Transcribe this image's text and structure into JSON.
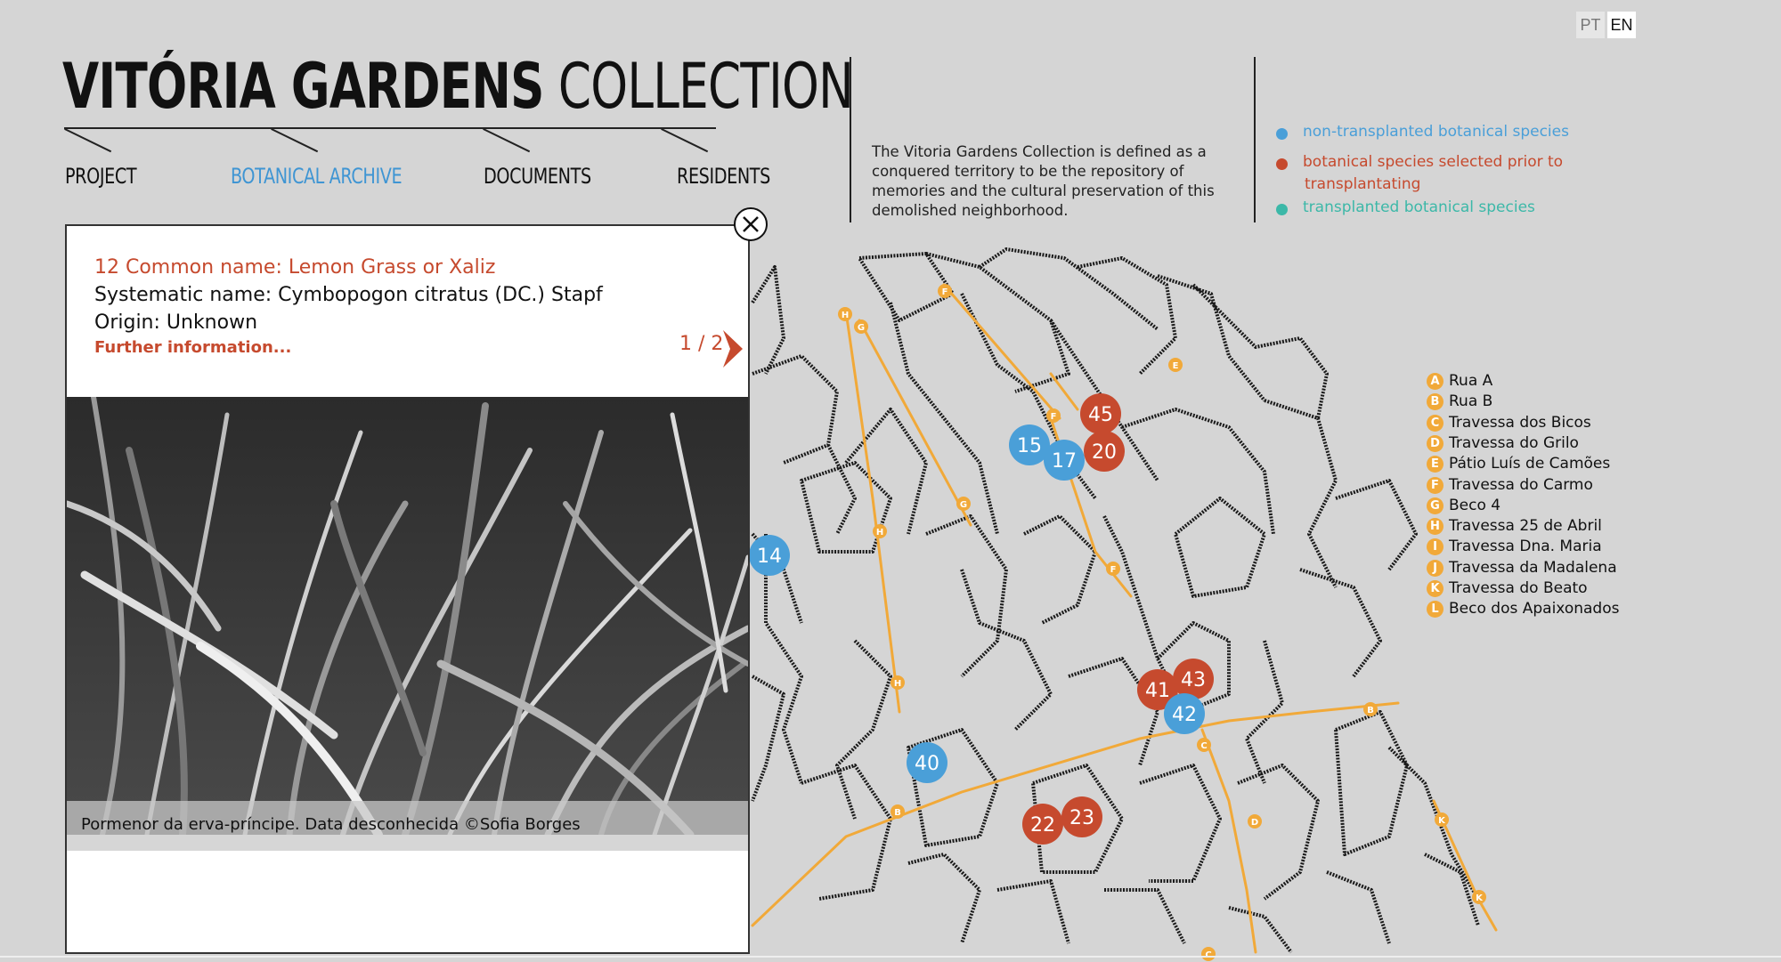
{
  "lang": {
    "pt": "PT",
    "en": "EN"
  },
  "title": {
    "bold": "VITÓRIA GARDENS",
    "light": " COLLECTION"
  },
  "nav": [
    {
      "label": "PROJECT"
    },
    {
      "label": "BOTANICAL ARCHIVE"
    },
    {
      "label": "DOCUMENTS"
    },
    {
      "label": "RESIDENTS"
    }
  ],
  "description": "The Vitoria Gardens Collection is defined as a conquered territory to be the repository of memories and the cultural preservation of this demolished neighborhood.",
  "legend": [
    {
      "label": "non-transplanted botanical species",
      "color": "#4a9fd8"
    },
    {
      "label": "botanical species selected prior to",
      "label2": "transplantating",
      "color": "#c64a2e"
    },
    {
      "label": "transplanted botanical species",
      "color": "#3cb8a8"
    }
  ],
  "colors": {
    "accent_blue": "#3f95d3",
    "accent_red": "#c64a2e",
    "route_orange": "#f1a939"
  },
  "streets": [
    {
      "letter": "A",
      "name": "Rua A"
    },
    {
      "letter": "B",
      "name": "Rua B"
    },
    {
      "letter": "C",
      "name": "Travessa dos Bicos"
    },
    {
      "letter": "D",
      "name": "Travessa do Grilo"
    },
    {
      "letter": "E",
      "name": "Pátio Luís de Camões"
    },
    {
      "letter": "F",
      "name": "Travessa do Carmo"
    },
    {
      "letter": "G",
      "name": "Beco 4"
    },
    {
      "letter": "H",
      "name": "Travessa 25 de Abril"
    },
    {
      "letter": "I",
      "name": "Travessa Dna. Maria"
    },
    {
      "letter": "J",
      "name": "Travessa da Madalena"
    },
    {
      "letter": "K",
      "name": "Travessa do Beato"
    },
    {
      "letter": "L",
      "name": "Beco dos Apaixonados"
    }
  ],
  "markers": [
    {
      "num": "45",
      "kind": "red"
    },
    {
      "num": "15",
      "kind": "blue"
    },
    {
      "num": "17",
      "kind": "blue"
    },
    {
      "num": "20",
      "kind": "red"
    },
    {
      "num": "14",
      "kind": "blue"
    },
    {
      "num": "43",
      "kind": "red"
    },
    {
      "num": "41",
      "kind": "red"
    },
    {
      "num": "42",
      "kind": "blue"
    },
    {
      "num": "40",
      "kind": "blue"
    },
    {
      "num": "23",
      "kind": "red"
    },
    {
      "num": "22",
      "kind": "red"
    }
  ],
  "route_labels": [
    "F",
    "H",
    "G",
    "E",
    "F",
    "G",
    "H",
    "F",
    "H",
    "B",
    "C",
    "B",
    "D",
    "K",
    "K",
    "C"
  ],
  "panel": {
    "common_name": "12 Common name: Lemon Grass or Xaliz",
    "systematic_name": "Systematic name: Cymbopogon citratus (DC.) Stapf",
    "origin": "Origin: Unknown",
    "further_link": "Further information...",
    "pager": "1 / 2",
    "caption": "Pormenor da erva-príncipe. Data desconhecida ©Sofia Borges"
  }
}
